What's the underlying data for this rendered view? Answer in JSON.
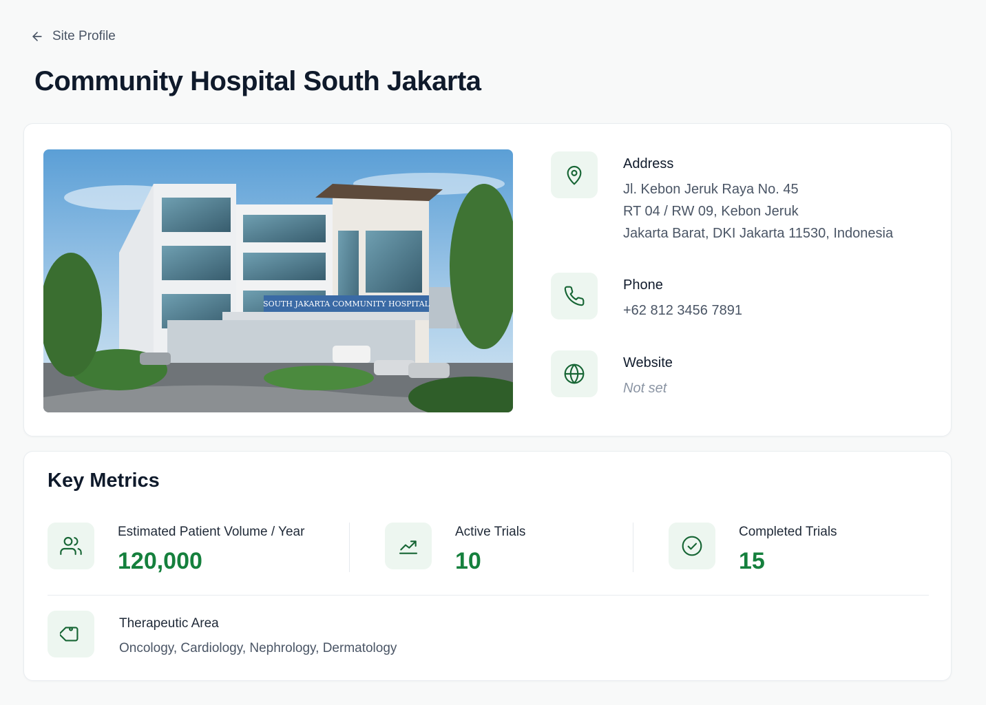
{
  "breadcrumb": {
    "back_label": "Site Profile",
    "back_icon": "arrow-left-icon"
  },
  "page": {
    "title": "Community Hospital South Jakarta"
  },
  "site": {
    "photo_alt": "Photo of the hospital building",
    "photo_sign_text": "SOUTH JAKARTA COMMUNITY HOSPITAL",
    "address": {
      "label": "Address",
      "icon": "map-pin-icon",
      "lines": [
        "Jl. Kebon Jeruk Raya No. 45",
        "RT 04 / RW 09, Kebon Jeruk",
        "Jakarta Barat, DKI Jakarta 11530, Indonesia"
      ]
    },
    "phone": {
      "label": "Phone",
      "icon": "phone-icon",
      "value": "+62 812 3456 7891"
    },
    "website": {
      "label": "Website",
      "icon": "globe-icon",
      "value": "Not set"
    }
  },
  "metrics": {
    "title": "Key Metrics",
    "items": [
      {
        "label": "Estimated Patient Volume / Year",
        "value": "120,000",
        "icon": "users-icon"
      },
      {
        "label": "Active Trials",
        "value": "10",
        "icon": "trending-up-icon"
      },
      {
        "label": "Completed Trials",
        "value": "15",
        "icon": "check-circle-icon"
      }
    ],
    "therapeutic_area": {
      "label": "Therapeutic Area",
      "value": "Oncology, Cardiology, Nephrology, Dermatology",
      "icon": "tag-icon"
    }
  },
  "colors": {
    "accent": "#15803d",
    "icon_bg": "#edf6f0",
    "icon_stroke": "#166534"
  }
}
